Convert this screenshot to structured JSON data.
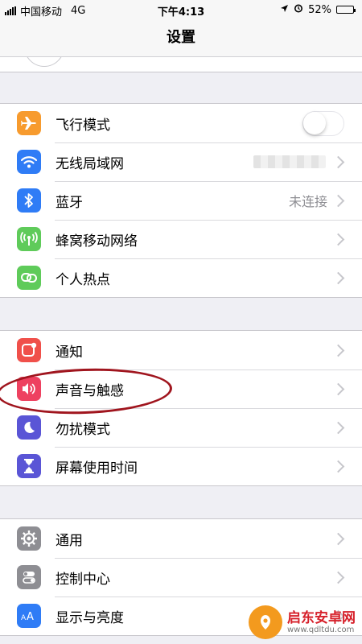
{
  "status_bar": {
    "carrier": "中国移动",
    "network": "4G",
    "time": "下午4:13",
    "battery": "52%",
    "battery_level": 0.52
  },
  "nav": {
    "title": "设置"
  },
  "groups": [
    {
      "rows": [
        {
          "label": "飞行模式",
          "icon": "airplane-icon",
          "color": "#f79b2e",
          "accessory": "toggle",
          "toggle_on": false
        },
        {
          "label": "无线局域网",
          "icon": "wifi-icon",
          "color": "#2f7cf6",
          "accessory": "blurred-chevron"
        },
        {
          "label": "蓝牙",
          "icon": "bluetooth-icon",
          "color": "#2f7cf6",
          "value": "未连接",
          "accessory": "chevron"
        },
        {
          "label": "蜂窝移动网络",
          "icon": "cellular-icon",
          "color": "#5fcb5a",
          "accessory": "chevron"
        },
        {
          "label": "个人热点",
          "icon": "hotspot-icon",
          "color": "#5fcb5a",
          "accessory": "chevron"
        }
      ]
    },
    {
      "rows": [
        {
          "label": "通知",
          "icon": "notification-icon",
          "color": "#f0504a",
          "accessory": "chevron"
        },
        {
          "label": "声音与触感",
          "icon": "sound-icon",
          "color": "#ee4160",
          "accessory": "chevron"
        },
        {
          "label": "勿扰模式",
          "icon": "moon-icon",
          "color": "#5a55d6",
          "accessory": "chevron"
        },
        {
          "label": "屏幕使用时间",
          "icon": "hourglass-icon",
          "color": "#5a55d6",
          "accessory": "chevron"
        }
      ]
    },
    {
      "rows": [
        {
          "label": "通用",
          "icon": "gear-icon",
          "color": "#8e8e93",
          "accessory": "chevron"
        },
        {
          "label": "控制中心",
          "icon": "control-center-icon",
          "color": "#8e8e93",
          "accessory": "chevron"
        },
        {
          "label": "显示与亮度",
          "icon": "display-icon",
          "color": "#2f7cf6",
          "accessory": "chevron"
        }
      ]
    }
  ],
  "watermark": {
    "name": "启东安卓网",
    "url": "www.qdltdu.com"
  }
}
